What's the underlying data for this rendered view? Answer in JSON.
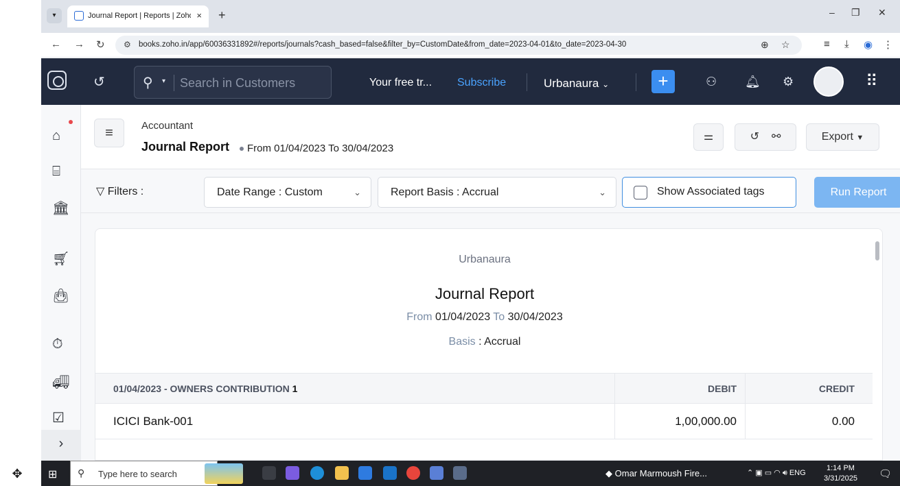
{
  "browser": {
    "tab_title": "Journal Report | Reports | Zoho",
    "tab_close": "×",
    "new_tab": "+",
    "url": "books.zoho.in/app/60036331892#/reports/journals?cash_based=false&filter_by=CustomDate&from_date=2023-04-01&to_date=2023-04-30"
  },
  "zoho_header": {
    "search_placeholder": "Search in Customers",
    "trial_text": "Your free tr...",
    "subscribe_label": "Subscribe",
    "org_name": "Urbanaura",
    "add_label": "+"
  },
  "page_header": {
    "breadcrumb": "Accountant",
    "title": "Journal Report",
    "date_range": "From 01/04/2023 To 30/04/2023",
    "export_label": "Export"
  },
  "filters": {
    "label": "Filters :",
    "date_range_label": "Date Range :",
    "date_range_value": "Custom",
    "report_basis_label": "Report Basis :",
    "report_basis_value": "Accrual",
    "tags_label": "Show Associated tags",
    "run_label": "Run Report"
  },
  "report": {
    "org": "Urbanaura",
    "title": "Journal Report",
    "from_label": "From",
    "from_date": "01/04/2023",
    "to_label": "To",
    "to_date": "30/04/2023",
    "basis_label": "Basis",
    "basis_value": "Accrual",
    "entry_heading": "01/04/2023 - OWNERS CONTRIBUTION",
    "entry_number": "1",
    "debit_header": "DEBIT",
    "credit_header": "CREDIT",
    "rows": [
      {
        "account": "ICICI Bank-001",
        "debit": "1,00,000.00",
        "credit": "0.00"
      }
    ]
  },
  "taskbar": {
    "search_placeholder": "Type here to search",
    "news": "Omar Marmoush Fire...",
    "lang": "ENG",
    "time": "1:14 PM",
    "date": "3/31/2025"
  },
  "colors": {
    "zoho_header": "#212a3e",
    "accent": "#3b8ef0",
    "run_button": "#7cb6f2",
    "close": "#e3343a"
  }
}
